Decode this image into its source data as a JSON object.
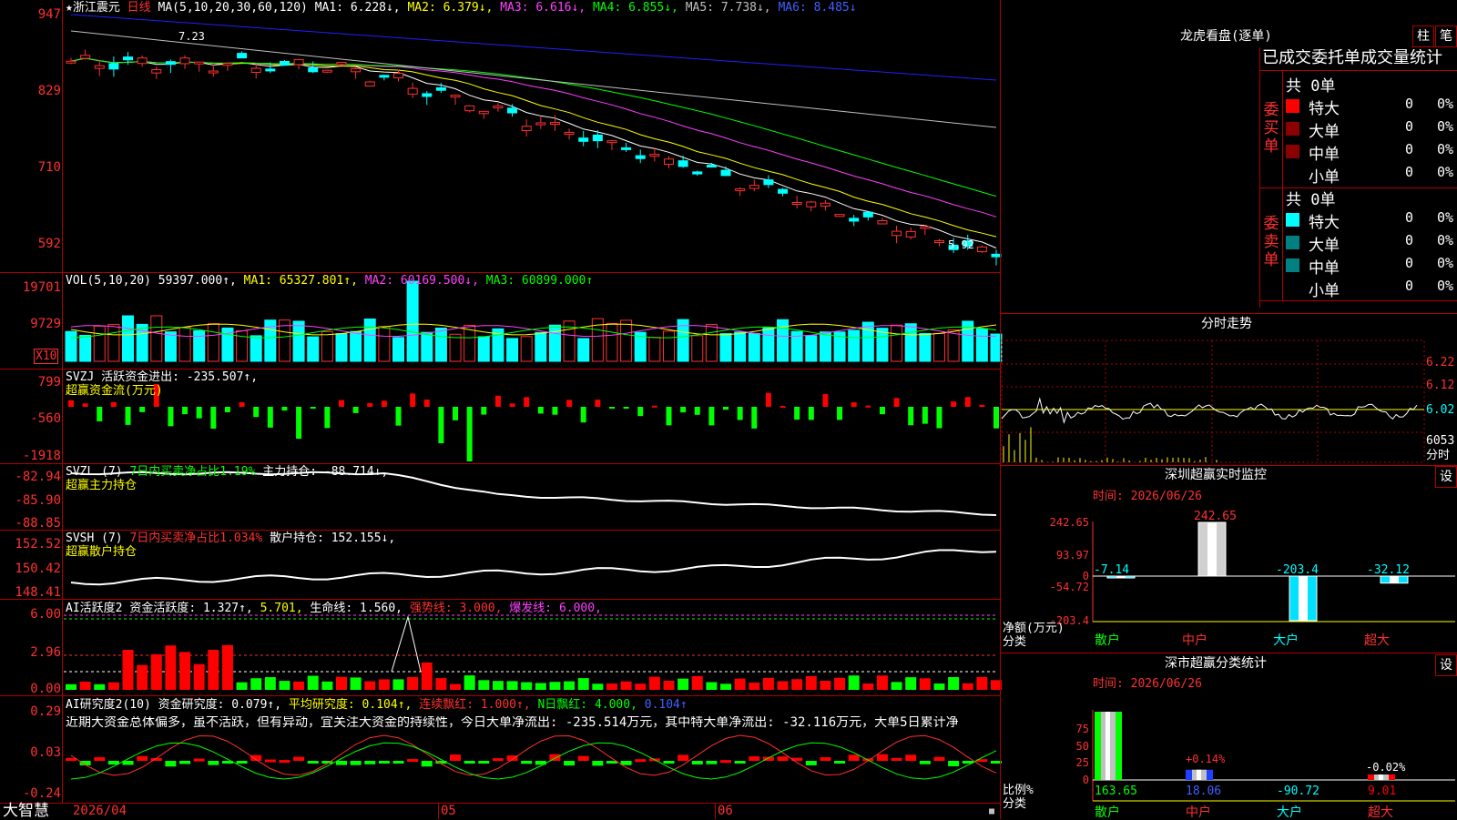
{
  "app": {
    "brand": "大智慧"
  },
  "stock": {
    "name": "浙江震元",
    "period": "日线",
    "last_price_label": "5.92"
  },
  "kline": {
    "ma_title": "MA(5,10,20,30,60,120)",
    "ma1": "MA1: 6.228↓,",
    "ma2": "MA2: 6.379↓,",
    "ma3": "MA3: 6.616↓,",
    "ma4": "MA4: 6.855↓,",
    "ma5": "MA5: 7.738↓,",
    "ma6": "MA6: 8.485↓",
    "peak_label": "7.23",
    "y_ticks": [
      "947",
      "829",
      "710",
      "592"
    ],
    "colors": {
      "ma1": "#ffffff",
      "ma2": "#ffff00",
      "ma3": "#ff40ff",
      "ma4": "#00ff00",
      "ma5": "#c0c0c0",
      "ma6": "#2020ff"
    }
  },
  "vol": {
    "title": "VOL(5,10,20)",
    "value": "59397.000↑,",
    "ma1": "MA1: 65327.801↑,",
    "ma2": "MA2: 60169.500↓,",
    "ma3": "MA3: 60899.000↑",
    "y_ticks": [
      "19701",
      "9729"
    ],
    "unit": "X10"
  },
  "svzj": {
    "title": "SVZJ",
    "label": "活跃资金进出: -235.507↑,",
    "sub": "超赢资金流(万元)",
    "y_ticks": [
      "799",
      "-560",
      "-1918"
    ]
  },
  "svzl": {
    "title": "SVZL (7)",
    "label1": "7日内买卖净占比1.19%",
    "label2": "主力持仓: -88.714↓,",
    "sub": "超赢主力持仓",
    "y_ticks": [
      "-82.94",
      "-85.90",
      "-88.85"
    ]
  },
  "svsh": {
    "title": "SVSH (7)",
    "label1": "7日内买卖净占比1.034%",
    "label2": "散户持仓: 152.155↓,",
    "sub": "超赢散户持仓",
    "y_ticks": [
      "152.52",
      "150.42",
      "148.41"
    ]
  },
  "ai_active": {
    "title": "AI活跃度2",
    "l1": "资金活跃度: 1.327↑,",
    "l2": "5.701,",
    "l3": "生命线: 1.560,",
    "l4": "强势线: 3.000,",
    "l5": "爆发线: 6.000,",
    "y_ticks": [
      "6.00",
      "2.96",
      "0.00"
    ]
  },
  "ai_research": {
    "title": "AI研究度2(10)",
    "l1": "资金研究度: 0.079↑,",
    "l2": "平均研究度: 0.104↑,",
    "l3": "连续飘红: 1.000↑,",
    "l4": "N日飘红: 4.000,",
    "l5": "0.104↑",
    "summary": "近期大资金总体偏多，虽不活跃，但有异动，宜关注大资金的持续性，今日大单净流出: -235.514万元，其中特大单净流出: -32.116万元，大单5日累计净",
    "y_ticks": [
      "0.29",
      "0.03",
      "-0.24"
    ]
  },
  "xaxis": {
    "labels": [
      "2026/04",
      "05",
      "06"
    ]
  },
  "longhu": {
    "title": "龙虎看盘(逐单)",
    "btn_zhu": "柱",
    "btn_bi": "笔",
    "subtitle": "已成交委托单成交量统计",
    "buy": {
      "side": "委买单",
      "total": "共 0单",
      "rows": [
        {
          "name": "特大",
          "count": "0",
          "pct": "0%",
          "color": "#ff0000"
        },
        {
          "name": "大单",
          "count": "0",
          "pct": "0%",
          "color": "#8b0000"
        },
        {
          "name": "中单",
          "count": "0",
          "pct": "0%",
          "color": "#8b0000"
        },
        {
          "name": "小单",
          "count": "0",
          "pct": "0%",
          "color": ""
        }
      ]
    },
    "sell": {
      "side": "委卖单",
      "total": "共 0单",
      "rows": [
        {
          "name": "特大",
          "count": "0",
          "pct": "0%",
          "color": "#00ffff"
        },
        {
          "name": "大单",
          "count": "0",
          "pct": "0%",
          "color": "#008080"
        },
        {
          "name": "中单",
          "count": "0",
          "pct": "0%",
          "color": "#008080"
        },
        {
          "name": "小单",
          "count": "0",
          "pct": "0%",
          "color": ""
        }
      ]
    }
  },
  "intraday": {
    "title": "分时走势",
    "y_ticks": [
      "6.22",
      "6.12",
      "6.02"
    ],
    "vol_label": "6053",
    "unit": "分时"
  },
  "monitor": {
    "title": "深圳超赢实时监控",
    "set": "设",
    "date": "时间: 2026/06/26",
    "y_ticks": [
      "242.65",
      "93.97",
      "0",
      "-54.72",
      "-203.4"
    ],
    "ylabel1": "净额(万元)",
    "ylabel2": "分类",
    "bars": [
      {
        "cat": "散户",
        "value": -7.14,
        "label": "-7.14"
      },
      {
        "cat": "中户",
        "value": 242.65,
        "label": "242.65"
      },
      {
        "cat": "大户",
        "value": -203.4,
        "label": "-203.4"
      },
      {
        "cat": "超大",
        "value": -32.12,
        "label": "-32.12"
      }
    ]
  },
  "classstat": {
    "title": "深市超赢分类统计",
    "set": "设",
    "date": "时间: 2026/06/26",
    "y_ticks": [
      "75",
      "50",
      "25",
      "0"
    ],
    "ylabel1": "比例%",
    "ylabel2": "分类",
    "pct_labels": [
      "+0.14%",
      "-0.02%"
    ],
    "bars": [
      {
        "cat": "散户",
        "pct": 100,
        "value": "163.65"
      },
      {
        "cat": "中户",
        "pct": 15,
        "value": "18.06"
      },
      {
        "cat": "大户",
        "pct": 0,
        "value": "-90.72"
      },
      {
        "cat": "超大",
        "pct": 8,
        "value": "9.01"
      }
    ]
  }
}
